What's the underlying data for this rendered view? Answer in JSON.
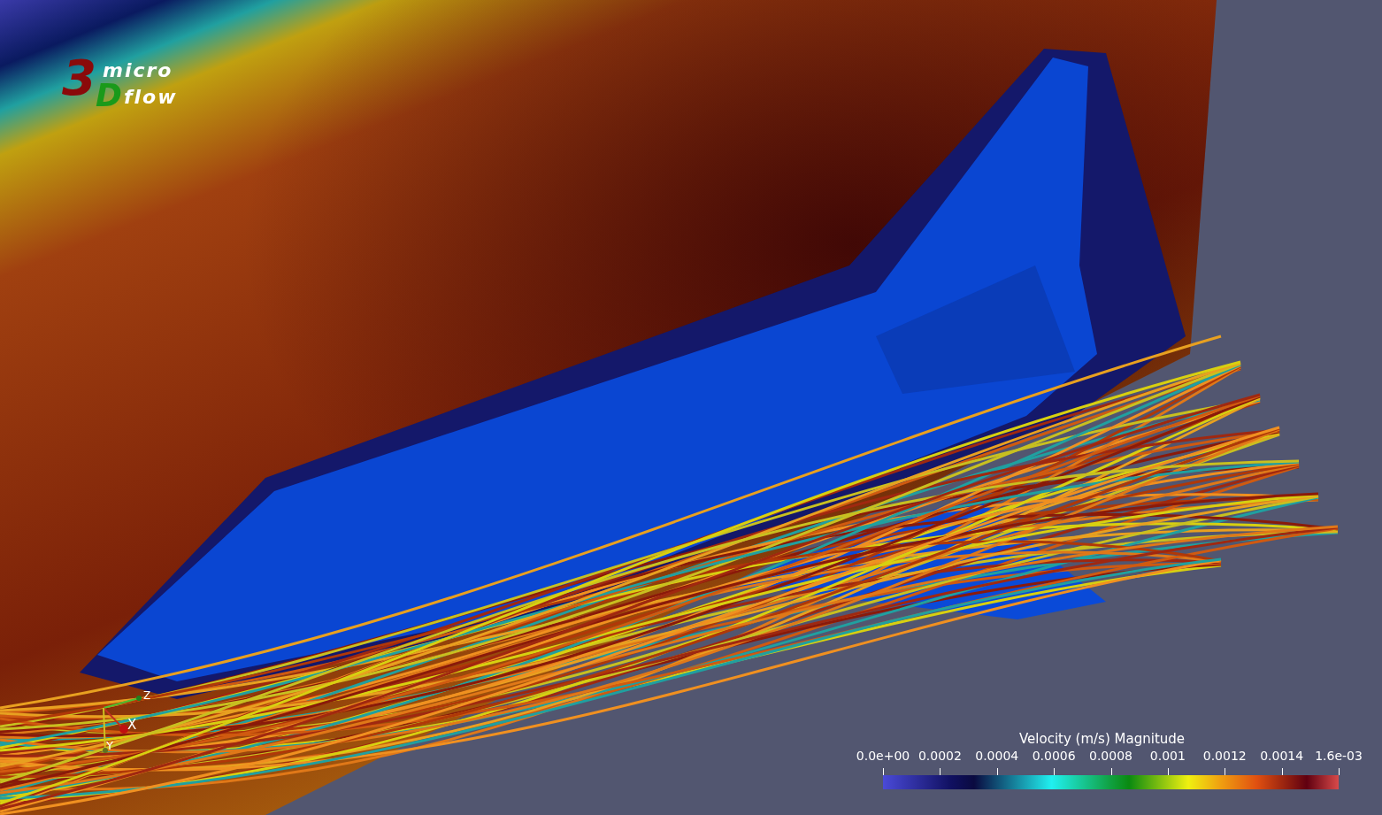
{
  "logo": {
    "digit": "3",
    "letter": "D",
    "words": [
      "micro",
      "flow"
    ]
  },
  "orientation_axes": {
    "labels": [
      "Z",
      "X",
      "Y"
    ]
  },
  "color_legend": {
    "title": "Velocity (m/s) Magnitude",
    "ticks": [
      "0.0e+00",
      "0.0002",
      "0.0004",
      "0.0006",
      "0.0008",
      "0.001",
      "0.0012",
      "0.0014",
      "1.6e-03"
    ]
  }
}
